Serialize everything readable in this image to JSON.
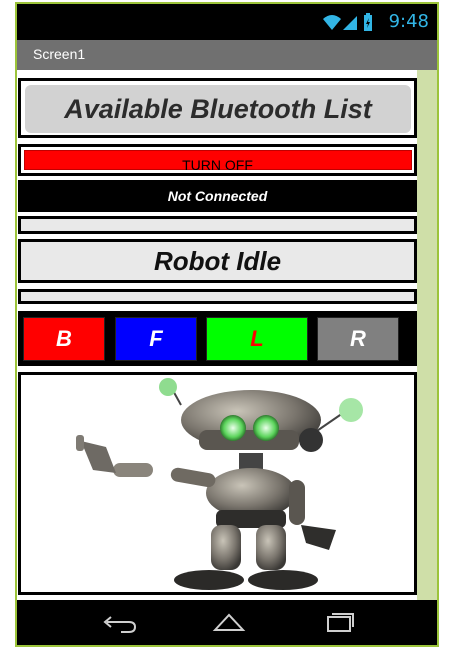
{
  "status_bar": {
    "time": "9:48",
    "icons": [
      "wifi-icon",
      "signal-icon",
      "battery-icon"
    ]
  },
  "title_bar": {
    "title": "Screen1"
  },
  "bluetooth_list_button": {
    "label": "Available Bluetooth List"
  },
  "turn_off_button": {
    "label": "TURN OFF",
    "color": "#ff0000"
  },
  "connection_status": {
    "text": "Not Connected"
  },
  "robot_status": {
    "text": "Robot Idle"
  },
  "controls": [
    {
      "label": "B",
      "color": "#ff0000",
      "text_color": "#ffffff"
    },
    {
      "label": "F",
      "color": "#0000ff",
      "text_color": "#ffffff"
    },
    {
      "label": "L",
      "color": "#00ff00",
      "text_color": "#ff0000"
    },
    {
      "label": "R",
      "color": "#808080",
      "text_color": "#ffffff"
    }
  ],
  "robot_image": {
    "icon": "robot-image"
  },
  "nav_bar": {
    "icons": [
      "back-icon",
      "home-icon",
      "recents-icon"
    ]
  },
  "colors": {
    "frame_border": "#9cc43a",
    "side_strip": "#cfdfa8",
    "accent_status": "#32b5e5"
  }
}
